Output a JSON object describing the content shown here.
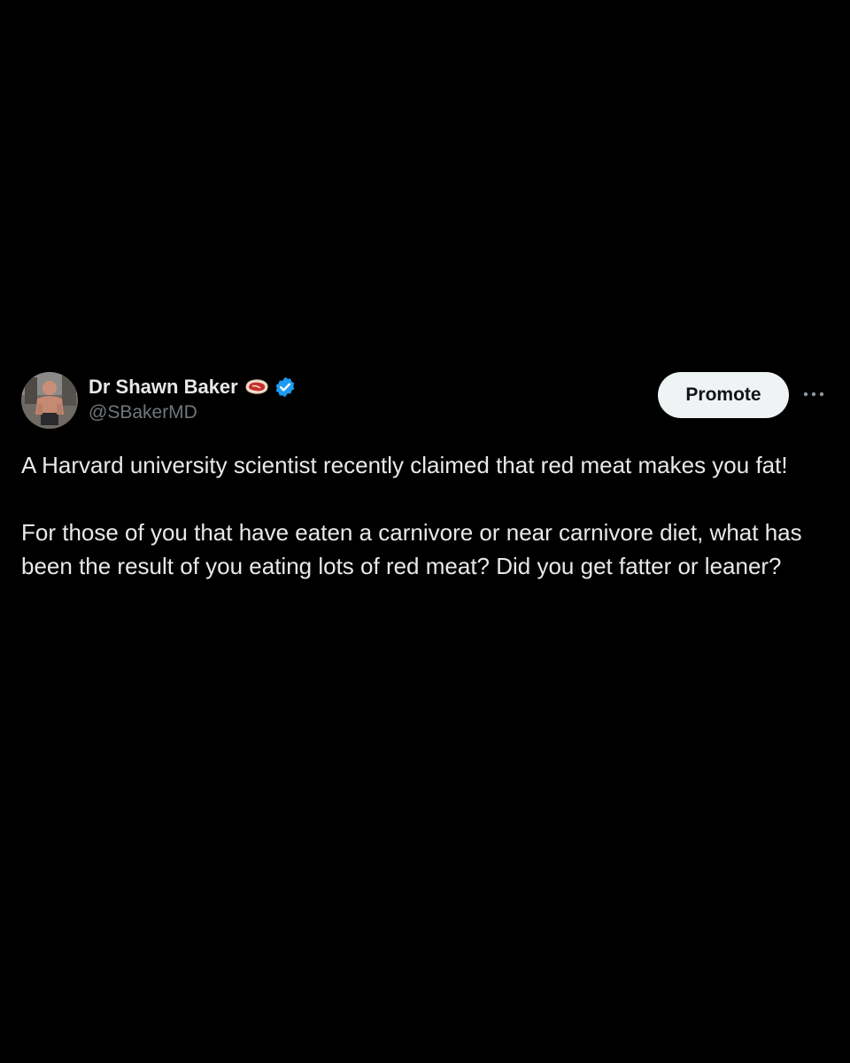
{
  "tweet": {
    "author": {
      "display_name": "Dr Shawn Baker",
      "handle": "@SBakerMD",
      "avatar_icon": "avatar-photo",
      "badge_emoji_icon": "steak-icon",
      "verified_icon": "verified-badge-icon",
      "verified_color": "#1d9bf0"
    },
    "promote_label": "Promote",
    "more_icon": "more-options-icon",
    "paragraphs": [
      "A Harvard university scientist recently claimed that red meat makes you fat!",
      "For those of you that have eaten a carnivore or near carnivore diet, what has been the result of you eating lots of red meat? Did you get fatter or leaner?"
    ]
  },
  "colors": {
    "background": "#000000",
    "text_primary": "#e7e9ea",
    "text_secondary": "#71767b",
    "button_bg": "#eff3f4",
    "button_text": "#0f1419"
  }
}
